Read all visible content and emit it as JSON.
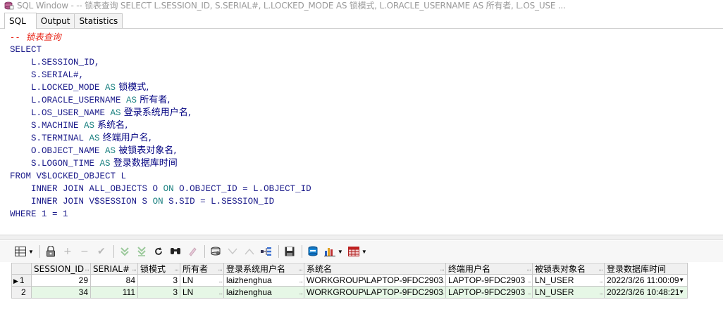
{
  "window": {
    "title": "SQL Window - -- 锁表查询 SELECT L.SESSION_ID, S.SERIAL#, L.LOCKED_MODE AS 锁模式, L.ORACLE_USERNAME AS 所有者, L.OS_USE ..."
  },
  "tabs": [
    {
      "label": "SQL"
    },
    {
      "label": "Output"
    },
    {
      "label": "Statistics"
    }
  ],
  "editor": {
    "comment": "-- 锁表查询",
    "select_kw": "SELECT",
    "cols": [
      {
        "expr": "L.SESSION_ID,",
        "as": "",
        "alias": ""
      },
      {
        "expr": "S.SERIAL#,",
        "as": "",
        "alias": ""
      },
      {
        "expr": "L.LOCKED_MODE ",
        "as": "AS",
        "alias": " 锁模式,"
      },
      {
        "expr": "L.ORACLE_USERNAME ",
        "as": "AS",
        "alias": " 所有者,"
      },
      {
        "expr": "L.OS_USER_NAME ",
        "as": "AS",
        "alias": " 登录系统用户名,"
      },
      {
        "expr": "S.MACHINE ",
        "as": "AS",
        "alias": " 系统名,"
      },
      {
        "expr": "S.TERMINAL ",
        "as": "AS",
        "alias": " 终端用户名,"
      },
      {
        "expr": "O.OBJECT_NAME ",
        "as": "AS",
        "alias": " 被锁表对象名,"
      },
      {
        "expr": "S.LOGON_TIME ",
        "as": "AS",
        "alias": " 登录数据库时间"
      }
    ],
    "from_line": "FROM V$LOCKED_OBJECT L",
    "join1_kw": "INNER JOIN",
    "join1_rest": " ALL_OBJECTS O ",
    "join1_on": "ON",
    "join1_cond": " O.OBJECT_ID = L.OBJECT_ID",
    "join2_kw": "INNER JOIN",
    "join2_rest": " V$SESSION S ",
    "join2_on": "ON",
    "join2_cond": " S.SID = L.SESSION_ID",
    "where_line": "WHERE 1 = 1"
  },
  "grid": {
    "columns": [
      "SESSION_ID",
      "SERIAL#",
      "锁模式",
      "所有者",
      "登录系统用户名",
      "系统名",
      "终端用户名",
      "被锁表对象名",
      "登录数据库时间"
    ],
    "rows": [
      {
        "n": "1",
        "session_id": "29",
        "serial": "84",
        "lock_mode": "3",
        "owner": "LN",
        "os_user": "laizhenghua",
        "machine": "WORKGROUP\\LAPTOP-9FDC2903",
        "terminal": "LAPTOP-9FDC2903",
        "object": "LN_USER",
        "logon": "2022/3/26 11:00:09"
      },
      {
        "n": "2",
        "session_id": "34",
        "serial": "111",
        "lock_mode": "3",
        "owner": "LN",
        "os_user": "laizhenghua",
        "machine": "WORKGROUP\\LAPTOP-9FDC2903",
        "terminal": "LAPTOP-9FDC2903",
        "object": "LN_USER",
        "logon": "2022/3/26 10:48:21"
      }
    ]
  },
  "colors": {
    "keyword": "#1a1a8a",
    "comment": "#e8281b",
    "row_alt": "#e6f7e6"
  },
  "icons": [
    "grid-icon",
    "lock-icon",
    "add-icon",
    "remove-icon",
    "check-icon",
    "next-icon",
    "last-icon",
    "refresh-icon",
    "find-icon",
    "clear-icon",
    "query-icon",
    "down-icon",
    "up-icon",
    "explain-icon",
    "save-icon",
    "export-icon",
    "chart-icon",
    "table-icon"
  ],
  "ellipsis": "..."
}
